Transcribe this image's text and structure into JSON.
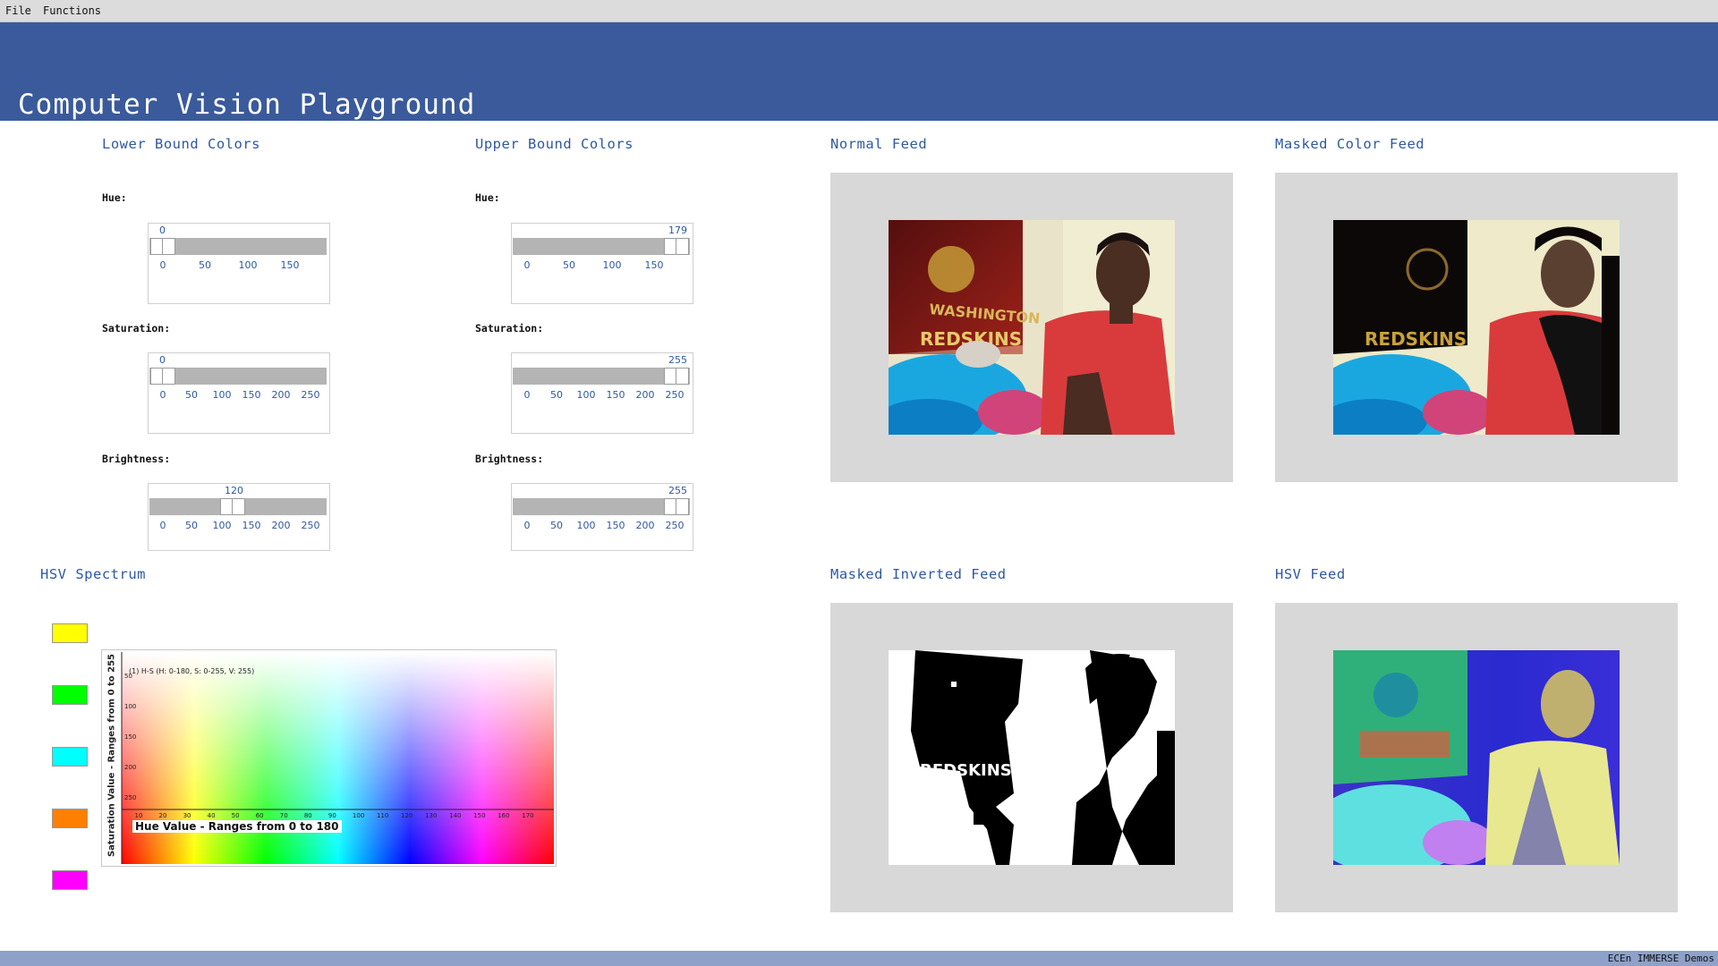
{
  "menu": {
    "file": "File",
    "functions": "Functions"
  },
  "app_title": "Computer Vision Playground",
  "lower": {
    "title": "Lower Bound Colors",
    "hue": {
      "label": "Hue:",
      "value": "0",
      "ticks": [
        "0",
        "50",
        "100",
        "150"
      ]
    },
    "saturation": {
      "label": "Saturation:",
      "value": "0",
      "ticks": [
        "0",
        "50",
        "100",
        "150",
        "200",
        "250"
      ]
    },
    "brightness": {
      "label": "Brightness:",
      "value": "120",
      "ticks": [
        "0",
        "50",
        "100",
        "150",
        "200",
        "250"
      ]
    }
  },
  "upper": {
    "title": "Upper Bound Colors",
    "hue": {
      "label": "Hue:",
      "value": "179",
      "ticks": [
        "0",
        "50",
        "100",
        "150"
      ]
    },
    "saturation": {
      "label": "Saturation:",
      "value": "255",
      "ticks": [
        "0",
        "50",
        "100",
        "150",
        "200",
        "250"
      ]
    },
    "brightness": {
      "label": "Brightness:",
      "value": "255",
      "ticks": [
        "0",
        "50",
        "100",
        "150",
        "200",
        "250"
      ]
    }
  },
  "feeds": {
    "normal": "Normal Feed",
    "masked_color": "Masked Color Feed",
    "masked_inverted": "Masked Inverted Feed",
    "hsv": "HSV Feed"
  },
  "hsv_spectrum": {
    "title": "HSV Spectrum",
    "swatch_colors": [
      "#ffff00",
      "#00ff00",
      "#00ffff",
      "#ff8000",
      "#ff00ff"
    ],
    "chart_caption": "(1) H-S (H: 0-180, S: 0-255, V: 255)",
    "y_axis_label": "Saturation Value - Ranges from 0 to 255",
    "x_axis_label": "Hue Value - Ranges from 0 to 180",
    "y_ticks": [
      "50",
      "100",
      "150",
      "200",
      "250"
    ],
    "x_ticks": [
      "10",
      "20",
      "30",
      "40",
      "50",
      "60",
      "70",
      "80",
      "90",
      "100",
      "110",
      "120",
      "130",
      "140",
      "150",
      "160",
      "170"
    ]
  },
  "footer": "ECEn IMMERSE Demos"
}
